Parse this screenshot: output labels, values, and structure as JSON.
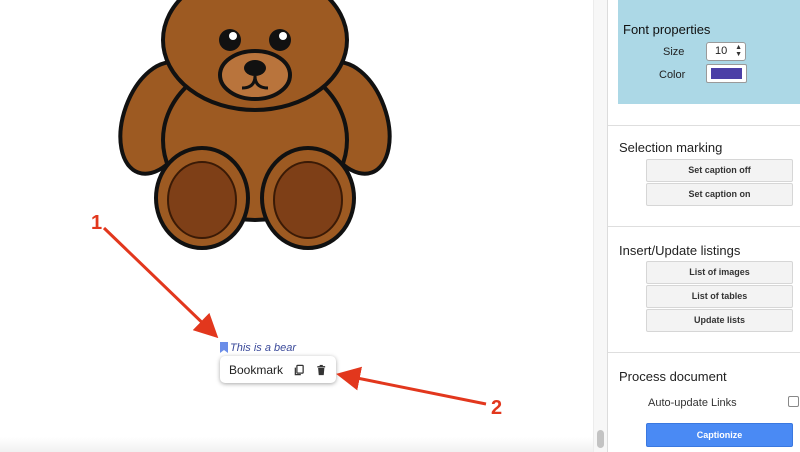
{
  "document": {
    "caption_text": "This is a bear",
    "bookmark_popup": {
      "label": "Bookmark",
      "copy_icon": "copy-icon",
      "delete_icon": "trash-icon"
    },
    "callouts": [
      {
        "number": "1"
      },
      {
        "number": "2"
      }
    ]
  },
  "panel": {
    "font_properties": {
      "title": "Font properties",
      "size_label": "Size",
      "size_value": "10",
      "color_label": "Color",
      "color_value": "#4b3fa6",
      "background_color": "#acd8e6"
    },
    "selection_marking": {
      "title": "Selection marking",
      "buttons": [
        "Set caption off",
        "Set caption on"
      ]
    },
    "listings": {
      "title": "Insert/Update listings",
      "buttons": [
        "List of images",
        "List of tables",
        "Update lists"
      ]
    },
    "process": {
      "title": "Process document",
      "auto_update_label": "Auto-update Links",
      "auto_update_checked": false,
      "captionize_label": "Captionize"
    }
  },
  "colors": {
    "accent_blue": "#4a8af4",
    "callout_red": "#e2371d",
    "caption_blue": "#3b4a9a",
    "bear_brown": "#9d5a22"
  }
}
